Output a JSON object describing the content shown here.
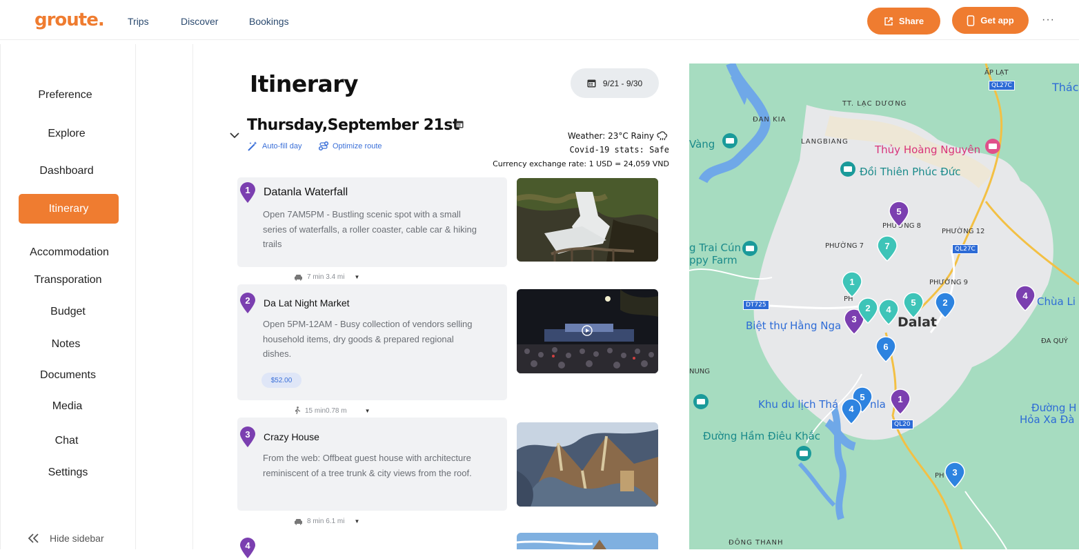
{
  "header": {
    "logo": "groute",
    "nav": [
      "Trips",
      "Discover",
      "Bookings"
    ],
    "share_label": "Share",
    "get_app_label": "Get app",
    "more_label": "···"
  },
  "sidebar": {
    "items": [
      "Preference",
      "Explore",
      "Dashboard",
      "Itinerary",
      "Accommodation",
      "Transporation",
      "Budget",
      "Notes",
      "Documents",
      "Media",
      "Chat",
      "Settings"
    ],
    "active": "Itinerary",
    "hide_label": "Hide sidebar"
  },
  "main": {
    "title": "Itinerary",
    "date_range": "9/21 - 9/30",
    "day_title": "Thursday,September 21st",
    "autofill_label": "Auto-fill day",
    "optimize_label": "Optimize route",
    "weather": "Weather: 23°C Rainy",
    "covid": "Covid-19 stats: Safe",
    "currency": "Currency exchange rate: 1 USD = 24,059 VND",
    "stops": [
      {
        "num": "1",
        "name": "Datanla Waterfall",
        "desc": "Open 7AM5PM - Bustling scenic spot with a small series of waterfalls, a roller coaster, cable car & hiking trails"
      },
      {
        "num": "2",
        "name": "Da Lat Night Market",
        "desc": "Open 5PM-12AM - Busy collection of vendors selling household items, dry goods & prepared regional dishes.",
        "price": "$52.00"
      },
      {
        "num": "3",
        "name": "Crazy House",
        "desc": "From the web: Offbeat guest house with architecture reminiscent of a tree trunk & city views from the roof."
      },
      {
        "num": "4"
      }
    ],
    "travel": [
      {
        "mode": "car-icon",
        "text": "7 min  3.4 mi"
      },
      {
        "mode": "walk-icon",
        "text": "15 min0.78 m"
      },
      {
        "mode": "car-icon",
        "text": "8 min  6.1 mi"
      }
    ]
  },
  "map": {
    "labels": {
      "ap_lat": "ẤP LẠT",
      "ql27c_top": "QL27C",
      "thac": "Thác",
      "tt_lac_duong": "TT. LẠC DƯƠNG",
      "dan_kia": "ĐAN KIA",
      "vang": "Vàng",
      "langbiang": "LANGBIANG",
      "thuy_hoang": "Thủy Hoàng Nguyên",
      "doi_thien": "Đồi Thiên Phúc Đức",
      "phuong8": "PHƯỜNG 8",
      "phuong12": "PHƯỜNG 12",
      "trai_cun": "g Trai Cún",
      "ppy_farm": "ppy Farm",
      "phuong7": "PHƯỜNG 7",
      "ql27c_mid": "QL27C",
      "phuong9": "PHƯỜNG 9",
      "chua_li": "Chùa Li",
      "dt725": "DT725",
      "phu": "PH",
      "biet_thu": "Biệt thự Hằng Nga",
      "dalat": "Dalat",
      "da_quy": "ĐA QUÝ",
      "nung": "NUNG",
      "khu_du_lich": "Khu du lịch Thá",
      "nla": "nla",
      "ql20": "QL20",
      "duong_h": "Đường H",
      "hoa_xa": "Hỏa Xa Đà",
      "duong_ham": "Đường Hầm Điêu Khắc",
      "phuong3": "PH   G 3",
      "dong_thanh": "ĐÔNG THANH"
    },
    "purple_pins": [
      "5",
      "3",
      "1",
      "4"
    ],
    "teal_pins": [
      "7",
      "1",
      "2",
      "4",
      "5"
    ],
    "blue_pins": [
      "2",
      "6",
      "5",
      "4",
      "3"
    ]
  }
}
